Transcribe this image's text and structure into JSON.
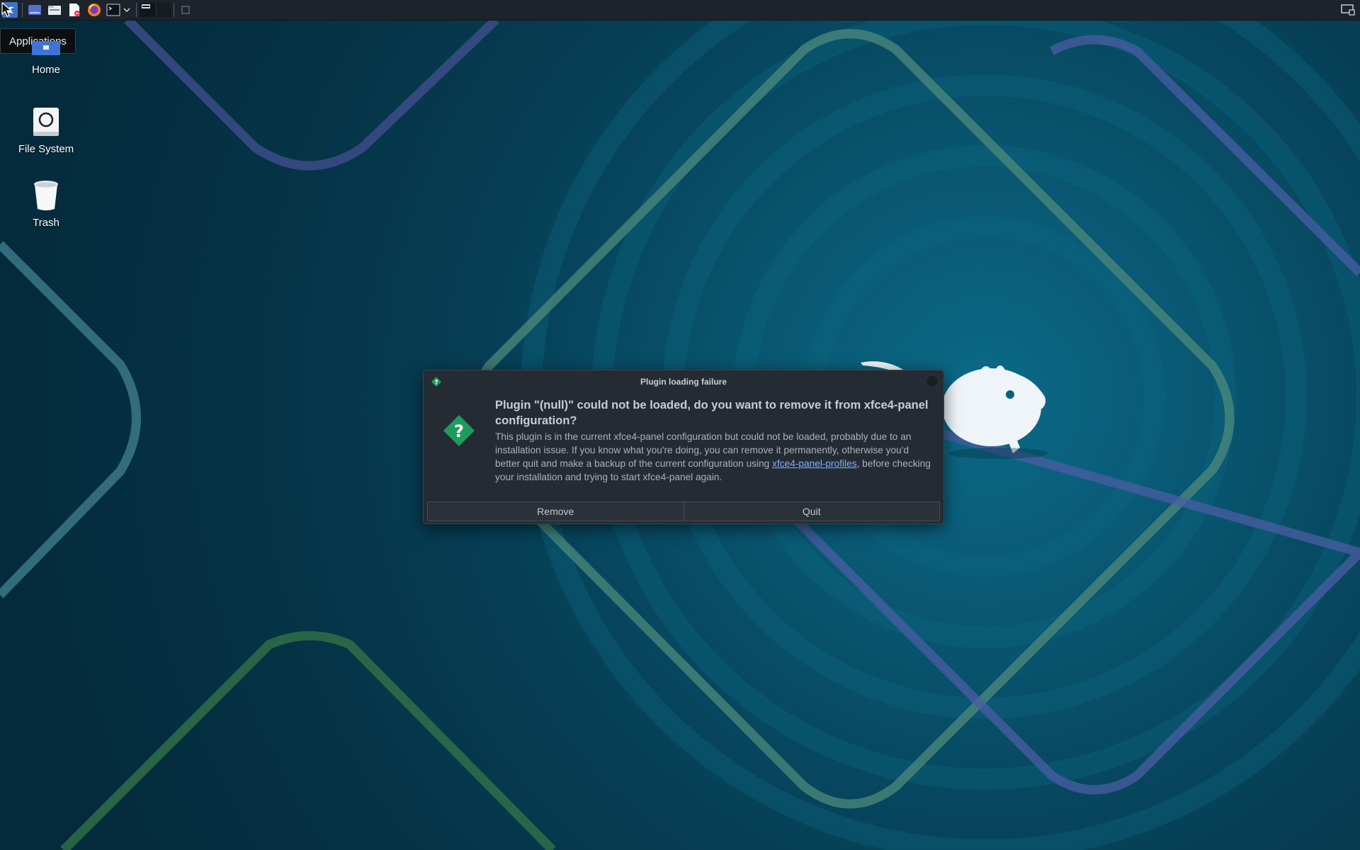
{
  "panel": {
    "tooltip": "Applications",
    "launchers": [
      "applications-menu-icon",
      "show-desktop-icon",
      "file-manager-icon",
      "text-editor-icon",
      "firefox-icon",
      "terminal-icon",
      "chevron-down-icon"
    ],
    "workspaces": [
      "workspace-1",
      "workspace-2"
    ],
    "accent": "#367bf0"
  },
  "desktop": {
    "icons": [
      {
        "label": "Home",
        "icon": "home-folder-icon"
      },
      {
        "label": "File System",
        "icon": "drive-icon"
      },
      {
        "label": "Trash",
        "icon": "trash-icon"
      }
    ]
  },
  "dialog": {
    "title": "Plugin loading failure",
    "headline": "Plugin \"(null)\" could not be loaded, do you want to remove it from xfce4-panel configuration?",
    "message_before": "This plugin is in the current xfce4-panel configuration but could not be loaded, probably due to an installation issue. If you know what you're doing, you can remove it permanently, otherwise you'd better quit and make a backup of the current configuration using ",
    "link": "xfce4-panel-profiles",
    "message_after": ", before checking your installation and trying to start xfce4-panel again.",
    "buttons": {
      "remove": "Remove",
      "quit": "Quit"
    },
    "icon": "question-icon",
    "icon_color": "#1e9c5d"
  }
}
